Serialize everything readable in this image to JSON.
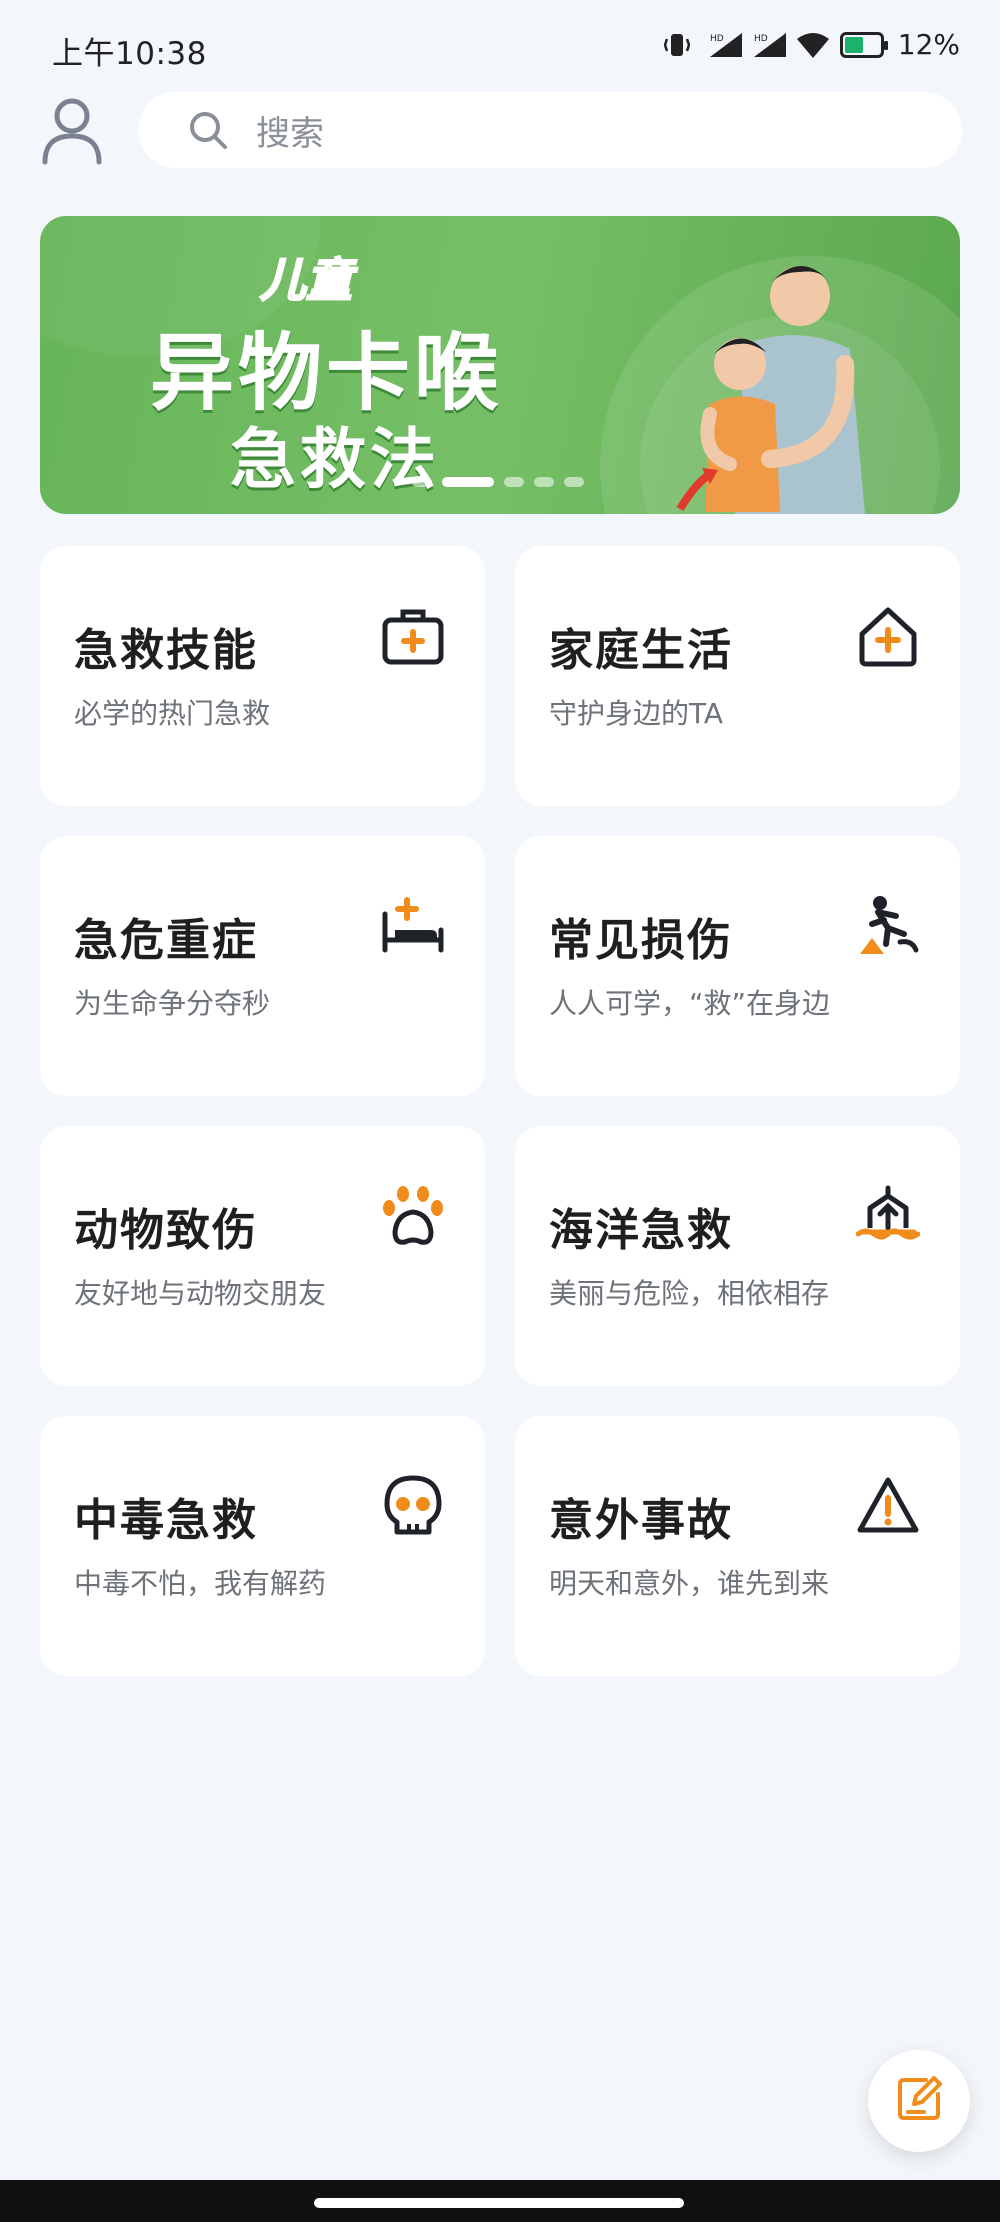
{
  "status_bar": {
    "time": "上午10:38",
    "battery_percent": "12%",
    "battery_level": 0.12
  },
  "search": {
    "placeholder": "搜索"
  },
  "banner": {
    "tag": "儿童",
    "title": "异物卡喉",
    "subtitle": "急救法",
    "slide_count": 5,
    "active_slide": 2
  },
  "categories": [
    {
      "title": "急救技能",
      "subtitle": "必学的热门急救",
      "icon": "first-aid-kit-icon"
    },
    {
      "title": "家庭生活",
      "subtitle": "守护身边的TA",
      "icon": "home-plus-icon"
    },
    {
      "title": "急危重症",
      "subtitle": "为生命争分夺秒",
      "icon": "hospital-bed-icon"
    },
    {
      "title": "常见损伤",
      "subtitle": "人人可学，“救”在身边",
      "icon": "falling-person-icon"
    },
    {
      "title": "动物致伤",
      "subtitle": "友好地与动物交朋友",
      "icon": "paw-icon"
    },
    {
      "title": "海洋急救",
      "subtitle": "美丽与危险，相依相存",
      "icon": "ship-icon"
    },
    {
      "title": "中毒急救",
      "subtitle": "中毒不怕，我有解药",
      "icon": "skull-icon"
    },
    {
      "title": "意外事故",
      "subtitle": "明天和意外，谁先到来",
      "icon": "warning-icon"
    }
  ],
  "colors": {
    "accent": "#f08c1c",
    "icon_dark": "#1f2329",
    "background": "#f3f6fa",
    "banner_green": "#6bb75c"
  },
  "fab": {
    "icon": "edit-note-icon"
  }
}
